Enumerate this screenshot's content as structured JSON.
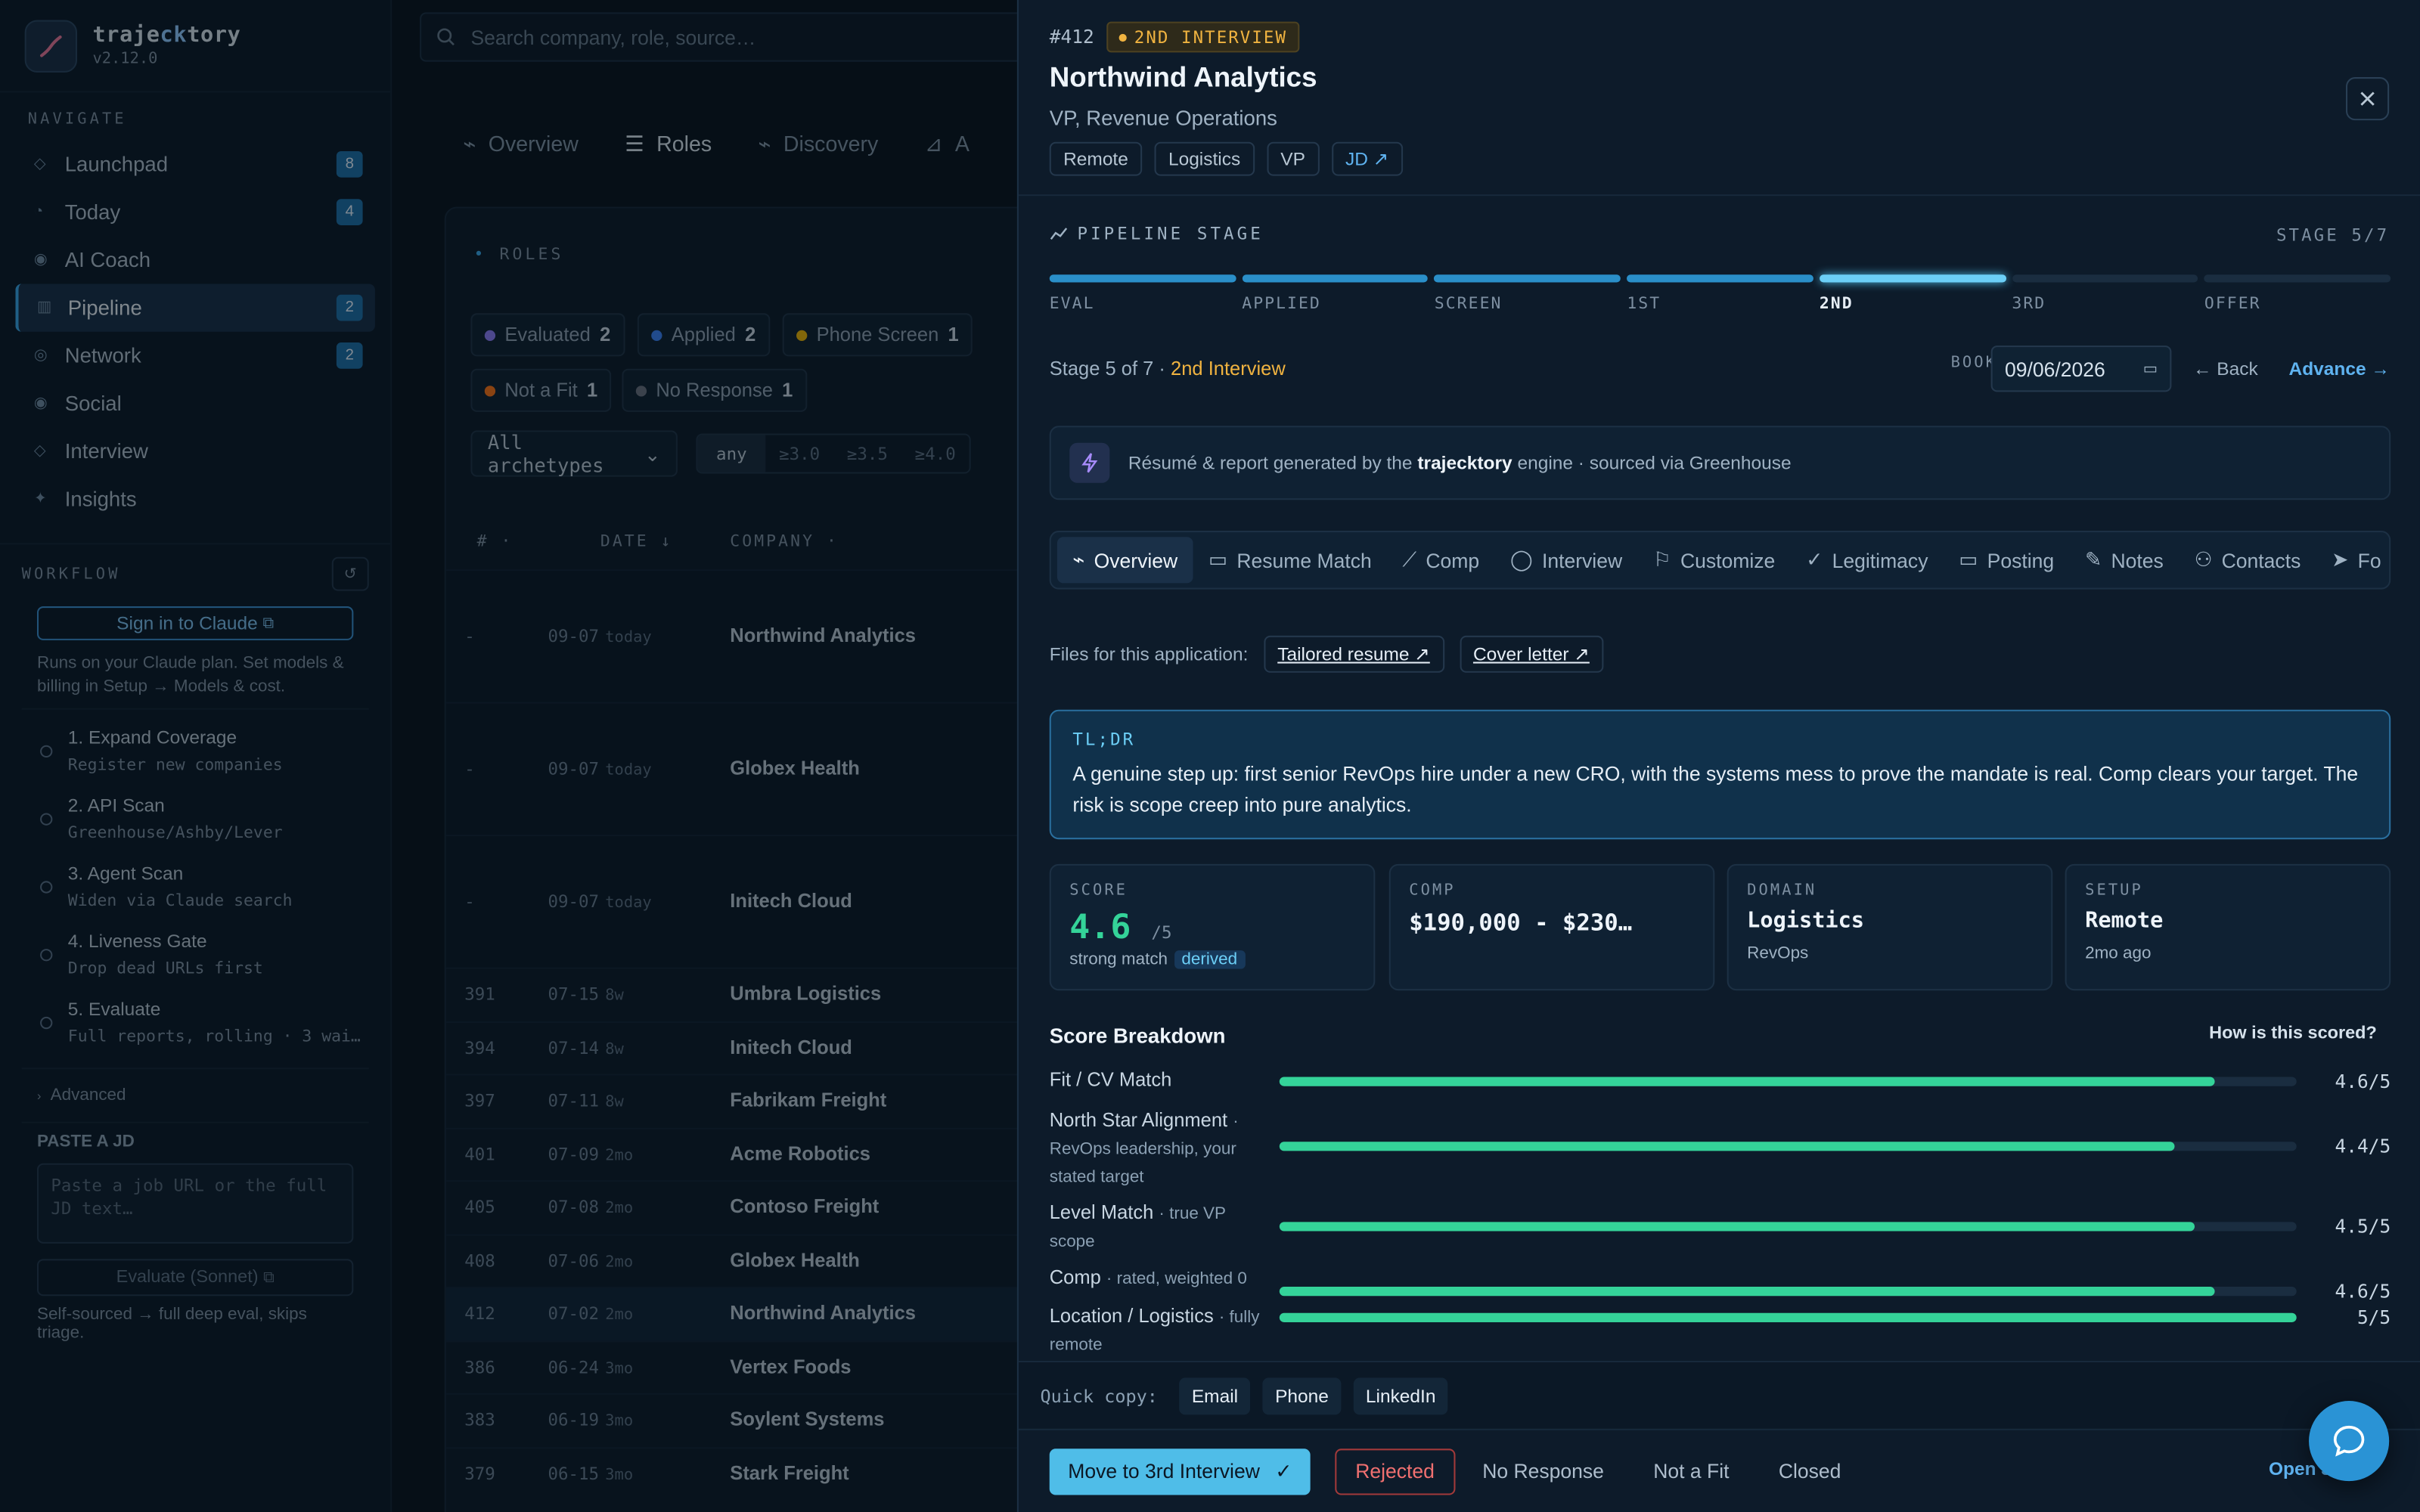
{
  "app": {
    "name_prefix": "traje",
    "name_accent": "ck",
    "name_suffix": "tory",
    "version": "v2.12.0"
  },
  "sidebar": {
    "navigate_title": "NAVIGATE",
    "nav": [
      {
        "label": "Launchpad",
        "badge": "8",
        "icon": "diamond-icon"
      },
      {
        "label": "Today",
        "badge": "4",
        "icon": "clock-icon"
      },
      {
        "label": "AI Coach",
        "badge": "",
        "icon": "circle-icon"
      },
      {
        "label": "Pipeline",
        "badge": "2",
        "icon": "columns-icon",
        "active": true
      },
      {
        "label": "Network",
        "badge": "2",
        "icon": "network-icon"
      },
      {
        "label": "Social",
        "badge": "",
        "icon": "circle-icon"
      },
      {
        "label": "Interview",
        "badge": "",
        "icon": "diamond-icon"
      },
      {
        "label": "Insights",
        "badge": "",
        "icon": "sparkle-icon"
      }
    ],
    "workflow_title": "WORKFLOW",
    "claude_btn": "Sign in to Claude",
    "workflow_note": "Runs on your Claude plan. Set models & billing in Setup → Models & cost.",
    "steps": [
      {
        "title": "1. Expand Coverage",
        "sub": "Register new companies"
      },
      {
        "title": "2. API Scan",
        "sub": "Greenhouse/Ashby/Lever"
      },
      {
        "title": "3. Agent Scan",
        "sub": "Widen via Claude search"
      },
      {
        "title": "4. Liveness Gate",
        "sub": "Drop dead URLs first"
      },
      {
        "title": "5. Evaluate",
        "sub": "Full reports, rolling · 3 wai…"
      }
    ],
    "advanced": "Advanced",
    "paste_title": "PASTE A JD",
    "paste_placeholder": "Paste a job URL or the full JD text…",
    "eval_btn": "Evaluate (Sonnet)",
    "self_note": "Self-sourced → full deep eval, skips triage."
  },
  "middle": {
    "search_placeholder": "Search company, role, source…",
    "tabs": [
      "Overview",
      "Roles",
      "Discovery",
      "A"
    ],
    "roles_title": "ROLES",
    "chips": [
      {
        "label": "Evaluated",
        "count": "2",
        "color": "#8b7cf6"
      },
      {
        "label": "Applied",
        "count": "2",
        "color": "#3b82f6"
      },
      {
        "label": "Phone Screen",
        "count": "1",
        "color": "#eab308"
      },
      {
        "label": "Not a Fit",
        "count": "1",
        "color": "#f97316"
      },
      {
        "label": "No Response",
        "count": "1",
        "color": "#6b7280"
      }
    ],
    "archetype": "All archetypes",
    "score_filters": [
      "any",
      "≥3.0",
      "≥3.5",
      "≥4.0"
    ],
    "headers": [
      "# ·",
      "DATE ↓",
      "COMPANY ·"
    ],
    "rows": [
      {
        "num": "-",
        "date": "09-07",
        "age": "today",
        "company": "Northwind Analytics"
      },
      {
        "num": "-",
        "date": "09-07",
        "age": "today",
        "company": "Globex Health"
      },
      {
        "num": "-",
        "date": "09-07",
        "age": "today",
        "company": "Initech Cloud"
      },
      {
        "num": "391",
        "date": "07-15",
        "age": "8w",
        "company": "Umbra Logistics"
      },
      {
        "num": "394",
        "date": "07-14",
        "age": "8w",
        "company": "Initech Cloud"
      },
      {
        "num": "397",
        "date": "07-11",
        "age": "8w",
        "company": "Fabrikam Freight"
      },
      {
        "num": "401",
        "date": "07-09",
        "age": "2mo",
        "company": "Acme Robotics"
      },
      {
        "num": "405",
        "date": "07-08",
        "age": "2mo",
        "company": "Contoso Freight"
      },
      {
        "num": "408",
        "date": "07-06",
        "age": "2mo",
        "company": "Globex Health"
      },
      {
        "num": "412",
        "date": "07-02",
        "age": "2mo",
        "company": "Northwind Analytics"
      },
      {
        "num": "386",
        "date": "06-24",
        "age": "3mo",
        "company": "Vertex Foods"
      },
      {
        "num": "383",
        "date": "06-19",
        "age": "3mo",
        "company": "Soylent Systems"
      },
      {
        "num": "379",
        "date": "06-15",
        "age": "3mo",
        "company": "Stark Freight"
      }
    ]
  },
  "detail": {
    "id": "#412",
    "stage_pill": "2ND INTERVIEW",
    "company": "Northwind Analytics",
    "role": "VP, Revenue Operations",
    "tags": [
      "Remote",
      "Logistics",
      "VP"
    ],
    "jd_link": "JD ↗",
    "pipeline_label": "PIPELINE STAGE",
    "stage_count": "STAGE 5/7",
    "stages": [
      "EVAL",
      "APPLIED",
      "SCREEN",
      "1ST",
      "2ND",
      "3RD",
      "OFFER"
    ],
    "stage_prefix": "Stage 5 of 7 ·",
    "stage_name": "2nd Interview",
    "booked_label": "BOOKED",
    "booked_date": "09/06/2026",
    "back": "← Back",
    "advance": "Advance →",
    "engine_pre": "Résumé & report generated by the",
    "engine_name": "trajecktory",
    "engine_post": "engine · sourced via Greenhouse",
    "tabs": [
      "Overview",
      "Resume Match",
      "Comp",
      "Interview",
      "Customize",
      "Legitimacy",
      "Posting",
      "Notes",
      "Contacts",
      "Fo"
    ],
    "files_label": "Files for this application:",
    "resume_link": "Tailored resume ↗",
    "cover_link": "Cover letter ↗",
    "tldr_title": "TL;DR",
    "tldr_body": "A genuine step up: first senior RevOps hire under a new CRO, with the systems mess to prove the mandate is real. Comp clears your target. The risk is scope creep into pure analytics.",
    "kpis": {
      "score": {
        "label": "SCORE",
        "value": "4.6",
        "unit": "/5",
        "sub": "strong match",
        "badge": "derived"
      },
      "comp": {
        "label": "COMP",
        "value": "$190,000 - $230…"
      },
      "domain": {
        "label": "DOMAIN",
        "value": "Logistics",
        "sub": "RevOps"
      },
      "setup": {
        "label": "SETUP",
        "value": "Remote",
        "sub": "2mo ago"
      }
    },
    "breakdown_title": "Score Breakdown",
    "breakdown_how": "How is this scored?",
    "breakdown": [
      {
        "label": "Fit / CV Match",
        "note": "",
        "value": "4.6/5",
        "pct": 0.92
      },
      {
        "label": "North Star Alignment",
        "note": "· RevOps leadership, your stated target",
        "value": "4.4/5",
        "pct": 0.88
      },
      {
        "label": "Level Match",
        "note": "· true VP scope",
        "value": "4.5/5",
        "pct": 0.9
      },
      {
        "label": "Comp",
        "note": "· rated, weighted 0",
        "value": "4.6/5",
        "pct": 0.92
      },
      {
        "label": "Location / Logistics",
        "note": "· fully remote",
        "value": "5/5",
        "pct": 1.0
      }
    ],
    "quick_copy_label": "Quick copy:",
    "quick_copy": [
      "Email",
      "Phone",
      "LinkedIn"
    ],
    "move_btn": "Move to 3rd Interview",
    "rejected": "Rejected",
    "no_response": "No Response",
    "not_fit": "Not a Fit",
    "closed": "Closed",
    "open": "Open J"
  }
}
